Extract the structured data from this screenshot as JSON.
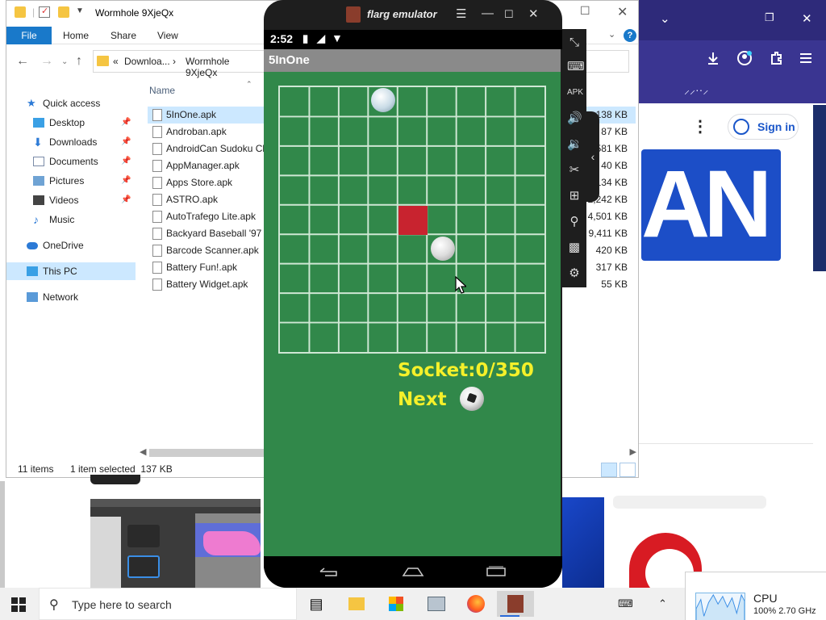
{
  "browser": {
    "sign_in_label": "Sign in",
    "logo_text": "AN",
    "strip_text": "⸝⸝··⸝",
    "blur_text": "",
    "colors": {
      "header": "#2e2a7a",
      "accent": "#1c4ec7"
    }
  },
  "explorer": {
    "window_title": "Wormhole 9XjeQx",
    "ribbon_tabs": [
      "File",
      "Home",
      "Share",
      "View"
    ],
    "address_crumbs": [
      "«",
      "Downloa...",
      "›",
      "Wormhole 9XjeQx"
    ],
    "sidebar": [
      {
        "label": "Quick access",
        "icon": "star-icon",
        "pinned": false
      },
      {
        "label": "Desktop",
        "icon": "desktop-folder-icon",
        "pinned": true
      },
      {
        "label": "Downloads",
        "icon": "downloads-folder-icon",
        "pinned": true
      },
      {
        "label": "Documents",
        "icon": "documents-folder-icon",
        "pinned": true
      },
      {
        "label": "Pictures",
        "icon": "pictures-folder-icon",
        "pinned": true
      },
      {
        "label": "Videos",
        "icon": "videos-folder-icon",
        "pinned": true
      },
      {
        "label": "Music",
        "icon": "music-icon",
        "pinned": false
      },
      {
        "label": "OneDrive",
        "icon": "cloud-icon",
        "pinned": false
      },
      {
        "label": "This PC",
        "icon": "computer-icon",
        "pinned": false,
        "selected": true
      },
      {
        "label": "Network",
        "icon": "network-icon",
        "pinned": false
      }
    ],
    "column_name": "Name",
    "files": [
      {
        "name": "5InOne.apk",
        "size": "138 KB",
        "selected": true
      },
      {
        "name": "Androban.apk",
        "size": "87 KB"
      },
      {
        "name": "AndroidCan Sudoku Ch",
        "size": "581 KB"
      },
      {
        "name": "AppManager.apk",
        "size": "40 KB"
      },
      {
        "name": "Apps Store.apk",
        "size": "134 KB"
      },
      {
        "name": "ASTRO.apk",
        "size": "2,242 KB"
      },
      {
        "name": "AutoTrafego Lite.apk",
        "size": "4,501 KB"
      },
      {
        "name": "Backyard Baseball '97 v",
        "size": "9,411 KB"
      },
      {
        "name": "Barcode Scanner.apk",
        "size": "420 KB"
      },
      {
        "name": "Battery Fun!.apk",
        "size": "317 KB"
      },
      {
        "name": "Battery Widget.apk",
        "size": "55 KB"
      }
    ],
    "status_count": "11 items",
    "status_selected": "1 item selected  137 KB"
  },
  "emulator": {
    "title": "flarg emulator",
    "time": "2:52",
    "app_title": "5InOne",
    "score_text": "Socket:0/350",
    "next_label": "Next",
    "colors": {
      "board": "#31884a",
      "text": "#f5f02a",
      "block": "#c8232f"
    },
    "grid_cols": 9,
    "grid_rows": 9
  },
  "taskbar": {
    "search_placeholder": "Type here to search",
    "cpu_label": "CPU",
    "cpu_value": "100%  2.70 GHz"
  }
}
